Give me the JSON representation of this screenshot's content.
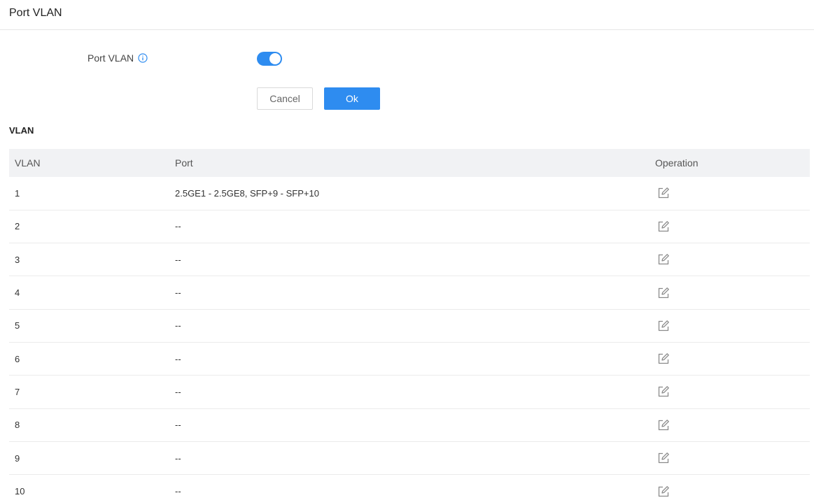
{
  "header": {
    "title": "Port VLAN"
  },
  "settings": {
    "port_vlan_label": "Port VLAN",
    "port_vlan_enabled": true,
    "cancel_label": "Cancel",
    "ok_label": "Ok"
  },
  "section": {
    "title": "VLAN"
  },
  "table": {
    "columns": [
      "VLAN",
      "Port",
      "Operation"
    ],
    "rows": [
      {
        "vlan": "1",
        "port": "2.5GE1 - 2.5GE8, SFP+9 - SFP+10"
      },
      {
        "vlan": "2",
        "port": "--"
      },
      {
        "vlan": "3",
        "port": "--"
      },
      {
        "vlan": "4",
        "port": "--"
      },
      {
        "vlan": "5",
        "port": "--"
      },
      {
        "vlan": "6",
        "port": "--"
      },
      {
        "vlan": "7",
        "port": "--"
      },
      {
        "vlan": "8",
        "port": "--"
      },
      {
        "vlan": "9",
        "port": "--"
      },
      {
        "vlan": "10",
        "port": "--"
      }
    ]
  },
  "colors": {
    "accent": "#2e8cf0",
    "header_bg": "#f1f2f4"
  },
  "icons": {
    "info": "info-icon",
    "edit": "edit-icon"
  }
}
